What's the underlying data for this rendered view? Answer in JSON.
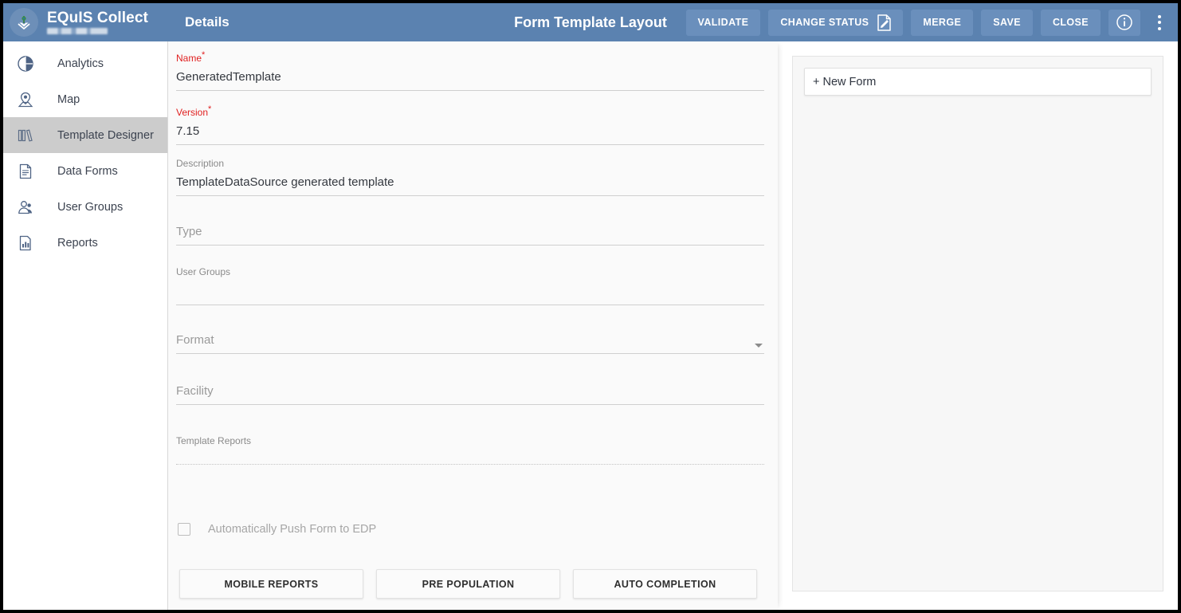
{
  "header": {
    "brand": "EQuIS Collect",
    "brand_subtitle_redacted": true,
    "details_label": "Details",
    "title": "Form Template Layout",
    "actions": [
      {
        "label": "VALIDATE",
        "icon": null
      },
      {
        "label": "CHANGE STATUS",
        "icon": "edit-document-icon"
      },
      {
        "label": "MERGE",
        "icon": null
      },
      {
        "label": "SAVE",
        "icon": null
      },
      {
        "label": "CLOSE",
        "icon": null
      }
    ],
    "info_icon": "info-circle-icon",
    "overflow_icon": "kebab-menu-icon"
  },
  "sidebar": {
    "items": [
      {
        "label": "Analytics",
        "icon": "pie-chart-icon",
        "active": false
      },
      {
        "label": "Map",
        "icon": "map-pin-icon",
        "active": false
      },
      {
        "label": "Template Designer",
        "icon": "books-icon",
        "active": true
      },
      {
        "label": "Data Forms",
        "icon": "document-icon",
        "active": false
      },
      {
        "label": "User Groups",
        "icon": "users-icon",
        "active": false
      },
      {
        "label": "Reports",
        "icon": "bar-chart-report-icon",
        "active": false
      }
    ]
  },
  "form": {
    "name": {
      "label": "Name",
      "required": true,
      "value": "GeneratedTemplate"
    },
    "version": {
      "label": "Version",
      "required": true,
      "value": "7.15"
    },
    "description": {
      "label": "Description",
      "required": false,
      "value": "TemplateDataSource generated template"
    },
    "type": {
      "label": "Type",
      "required": false,
      "value": ""
    },
    "user_groups": {
      "label": "User Groups",
      "required": false,
      "value": ""
    },
    "format": {
      "label": "Format",
      "required": false,
      "value": "",
      "caret": "chevron-down-icon"
    },
    "facility": {
      "label": "Facility",
      "required": false,
      "value": ""
    },
    "template_reports": {
      "label": "Template Reports",
      "required": false,
      "value": ""
    },
    "auto_push": {
      "label": "Automatically Push Form to EDP",
      "checked": false,
      "disabled": true
    },
    "buttons": [
      {
        "label": "MOBILE REPORTS"
      },
      {
        "label": "PRE POPULATION"
      },
      {
        "label": "AUTO COMPLETION"
      }
    ]
  },
  "right_panel": {
    "new_form_label": "+ New Form"
  },
  "colors": {
    "appbar": "#5b82b0",
    "appbar_button": "#6a8fbc",
    "sidebar_active": "#cccccc",
    "required_label": "#e02020",
    "page_bg": "#fafafa"
  }
}
